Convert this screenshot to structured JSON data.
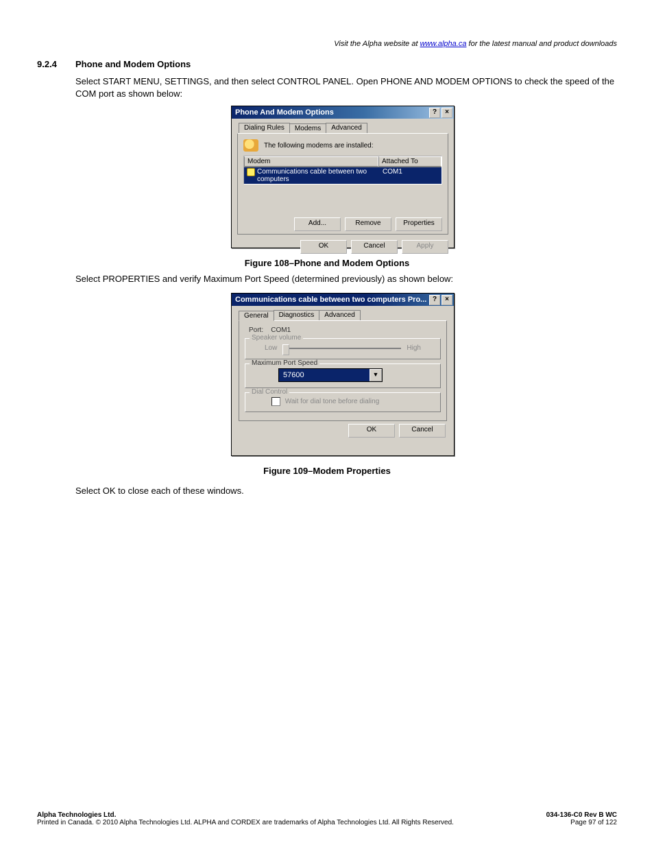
{
  "header": {
    "prefix": "Visit the Alpha website at ",
    "link_text": "www.alpha.ca",
    "suffix": " for the latest manual and product downloads"
  },
  "section": {
    "number": "9.2.4",
    "title": "Phone and Modem Options"
  },
  "paragraphs": {
    "p1": "Select START MENU, SETTINGS, and then select CONTROL PANEL. Open PHONE AND MODEM OPTIONS to check the speed of the COM port as shown below:",
    "p2": "Select PROPERTIES and verify Maximum Port Speed (determined previously) as shown below:",
    "p3": "Select OK to close each of these windows."
  },
  "figure_captions": {
    "f108": "Figure 108–Phone and Modem Options",
    "f109": "Figure 109–Modem Properties"
  },
  "dialog1": {
    "title": "Phone And Modem Options",
    "help_glyph": "?",
    "close_glyph": "×",
    "tabs": {
      "t1": "Dialing Rules",
      "t2": "Modems",
      "t3": "Advanced"
    },
    "info": "The following modems are installed:",
    "columns": {
      "c1": "Modem",
      "c2": "Attached To"
    },
    "row": {
      "name": "Communications cable between two computers",
      "port": "COM1"
    },
    "buttons": {
      "add": "Add...",
      "remove": "Remove",
      "properties": "Properties"
    },
    "bottom": {
      "ok": "OK",
      "cancel": "Cancel",
      "apply": "Apply"
    }
  },
  "dialog2": {
    "title": "Communications cable between two computers Pro...",
    "help_glyph": "?",
    "close_glyph": "×",
    "tabs": {
      "t1": "General",
      "t2": "Diagnostics",
      "t3": "Advanced"
    },
    "port_label": "Port:",
    "port_value": "COM1",
    "group_speaker": "Speaker volume",
    "low": "Low",
    "high": "High",
    "group_speed": "Maximum Port Speed",
    "speed_value": "57600",
    "group_dial": "Dial Control",
    "dial_check": "Wait for dial tone before dialing",
    "ok": "OK",
    "cancel": "Cancel"
  },
  "footer": {
    "left1": "Alpha Technologies Ltd.",
    "right1": "034-136-C0  Rev B  WC",
    "left2": "Printed in Canada.  © 2010 Alpha Technologies Ltd.  ALPHA and CORDEX are trademarks of Alpha Technologies Ltd.  All Rights Reserved.",
    "right2": "Page 97 of 122"
  }
}
